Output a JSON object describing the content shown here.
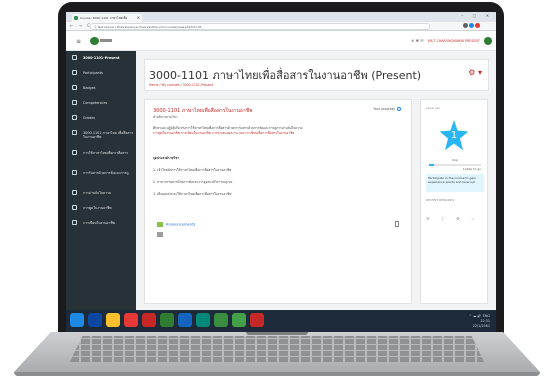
{
  "browser": {
    "tab_title": "Course: 3000-1101 ภาษาไทยเพื่อ",
    "tab_close": "×",
    "window_controls": "– ▢ ✕",
    "nav_controls": "← → C ⌂",
    "url": "Ⓘ Not secure | thaivanpanya.chiaovanthai.com/course/view.php?id=18"
  },
  "topbar": {
    "hamburger": "≡",
    "icons": "⊕ ✱ ✉",
    "user_name": "MS.T CHARONGMANYA PRESENT"
  },
  "sidebar": {
    "items": [
      {
        "label": "3000-1101-Present",
        "active": true
      },
      {
        "label": "Participants"
      },
      {
        "label": "Badges"
      },
      {
        "label": "Competencies"
      },
      {
        "label": "Grades"
      },
      {
        "label": "3000-1101 ภาษาไทย เพื่อสื่อสารในงานอาชีพ"
      },
      {
        "label": "การใช้ภาษาไทยเพื่อการสื่อสาร"
      },
      {
        "label": "การรับสารด้วยการฟังและการดู"
      },
      {
        "label": "การอ่านจับใจความ"
      },
      {
        "label": "การพูดในงานอาชีพ"
      },
      {
        "label": "การเขียนในงานอาชีพ"
      }
    ]
  },
  "header": {
    "title": "3000-1101 ภาษาไทยเพื่อสื่อสารในงานอาชีพ (Present)",
    "breadcrumb": "Home / My courses / 3000-1101-Present",
    "cog": "⚙ ▾"
  },
  "course": {
    "title": "3000-1101 ภาษาไทยเพื่อสื่อสารในงานอาชีพ",
    "progress_label": "Your progress",
    "subtitle": "คำอธิบายรายวิชา",
    "body_1": "ศึกษาและปฏิบัติเกี่ยวกับการใช้ภาษาไทยเพื่อการสื่อสารด้วยการรับสารด้วยการฟังและการดูการอ่านจับใจความ",
    "body_2": "การพูดในงานอาชีพ การเขียนในงานอาชีพ การนำเสนอผลงาน และการเขียนเพื่อการสื่อสารในงานอาชีพ",
    "objectives_title": "จุดประสงค์รายวิชา",
    "objectives": [
      "1. เข้าใจหลักการใช้ภาษาไทยเพื่อการสื่อสารในงานอาชีพ",
      "2. สามารถรับสารด้วยการฟังและการดูอย่างมีวิจารณญาณ",
      "3. เห็นคุณค่าและใช้ภาษาไทยเพื่อการสื่อสารในงานอาชีพ"
    ],
    "announcements": "Announcements"
  },
  "level_block": {
    "label": "Level up!",
    "level": "1",
    "xp_label": "0xp",
    "xp_value": "120xp to go",
    "xp_fraction": 0.1,
    "note": "Participate in the course to gain experience points and level up!",
    "recent": "RECENT REWARDS",
    "icons": "☰ ⓘ ⚙ ☆"
  },
  "taskbar": {
    "time": "12:31",
    "date": "22/1/2561",
    "tray_icons": "^ ☁ 🔊 ENG"
  },
  "colors": {
    "accent": "#c62828",
    "sidebar": "#263238",
    "star": "#29b6f6",
    "taskbar": "#1c2a3a"
  }
}
